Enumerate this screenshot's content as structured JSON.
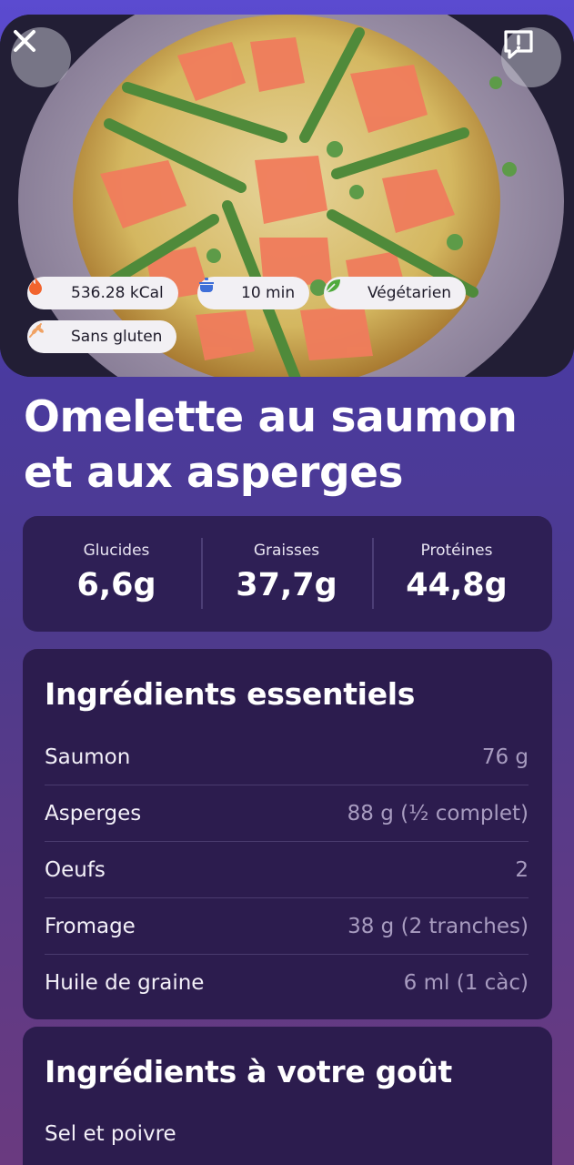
{
  "badges": [
    {
      "label": "536.28 kCal",
      "icon": "fire-icon"
    },
    {
      "label": "10 min",
      "icon": "cooking-pot-icon"
    },
    {
      "label": "Végétarien",
      "icon": "leaf-icon"
    },
    {
      "label": "Sans gluten",
      "icon": "wheat-icon"
    }
  ],
  "recipe": {
    "title": "Omelette au saumon et aux asperges"
  },
  "macros": [
    {
      "label": "Glucides",
      "value": "6,6g"
    },
    {
      "label": "Graisses",
      "value": "37,7g"
    },
    {
      "label": "Protéines",
      "value": "44,8g"
    }
  ],
  "essentials": {
    "title": "Ingrédients essentiels",
    "items": [
      {
        "name": "Saumon",
        "quantity": "76 g"
      },
      {
        "name": "Asperges",
        "quantity": "88 g (½ complet)"
      },
      {
        "name": "Oeufs",
        "quantity": "2"
      },
      {
        "name": "Fromage",
        "quantity": "38 g (2 tranches)"
      },
      {
        "name": "Huile de graine",
        "quantity": "6 ml (1 càc)"
      }
    ]
  },
  "to_taste": {
    "title": "Ingrédients à votre goût",
    "items": [
      {
        "name": "Sel et poivre"
      }
    ]
  },
  "colors": {
    "background_top": "#5b4bd0",
    "card": "#2c1c4e",
    "macro_card": "#2e1f55",
    "muted_text": "#a89cc0",
    "chip_bg": "#f2f0f4"
  }
}
